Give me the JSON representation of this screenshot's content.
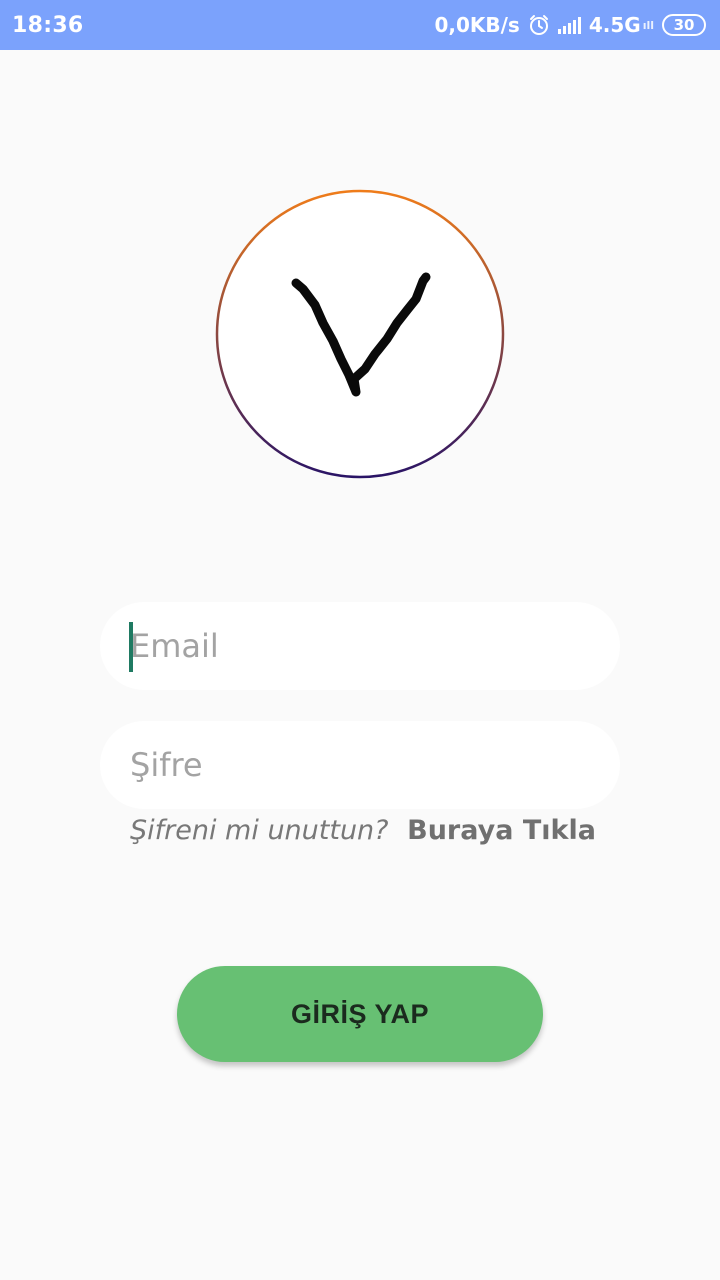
{
  "status_bar": {
    "time": "18:36",
    "net_speed": "0,0KB/s",
    "network_type": "4.5G",
    "network_sub": "ıll",
    "battery": "30",
    "icons": [
      "alarm-icon",
      "signal-icon",
      "battery-icon"
    ]
  },
  "logo": {
    "icon": "handwritten-v-logo",
    "ring_colors": [
      "#ef7c1a",
      "#2a1466"
    ]
  },
  "form": {
    "email_placeholder": "Email",
    "email_value": "",
    "password_placeholder": "Şifre",
    "password_value": "",
    "forgot_question": "Şifreni mi unuttun?",
    "forgot_link": "Buraya Tıkla"
  },
  "login_button": {
    "label": "GİRİŞ YAP"
  },
  "colors": {
    "status_bar": "#7ba2fc",
    "background": "#fafafa",
    "button": "#67c073",
    "caret": "#1f7a62"
  }
}
